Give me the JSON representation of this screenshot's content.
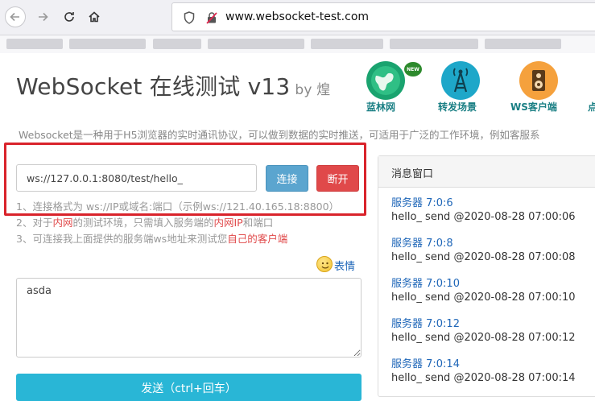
{
  "browser": {
    "url": "www.websocket-test.com"
  },
  "header": {
    "title": "WebSocket 在线测试 v13",
    "by": "by 煌",
    "nav": [
      {
        "label": "蓝林网",
        "icon": "globe-icon",
        "color": "#1aa36f"
      },
      {
        "label": "转发场景",
        "icon": "antenna-icon",
        "color": "#1ea7c9"
      },
      {
        "label": "WS客户端",
        "icon": "speaker-icon",
        "color": "#f5a13d"
      },
      {
        "label": "点"
      }
    ],
    "new_badge": "NEW"
  },
  "intro": "Websocket是一种用于H5浏览器的实时通讯协议，可以做到数据的实时推送，可适用于广泛的工作环境，例如客服系",
  "connection": {
    "url_value": "ws://127.0.0.1:8080/test/hello_",
    "connect_label": "连接",
    "disconnect_label": "断开"
  },
  "tips": {
    "tip1": "1、连接格式为 ws://IP或域名:端口（示例ws://121.40.165.18:8800）",
    "tip2_pre": "2、对于",
    "tip2_hl1": "内网",
    "tip2_mid": "的测试环境，只需填入服务端的",
    "tip2_hl2": "内网IP",
    "tip2_post": "和端口",
    "tip3_pre": "3、可连接我上面提供的服务端ws地址来测试您",
    "tip3_hl": "自己的客户端"
  },
  "emoji_label": "表情",
  "message_input": "asda",
  "send_label": "发送（ctrl+回车）",
  "panel": {
    "title": "消息窗口",
    "messages": [
      {
        "from": "服务器 7:0:6",
        "body": "hello_ send @2020-08-28 07:00:06"
      },
      {
        "from": "服务器 7:0:8",
        "body": "hello_ send @2020-08-28 07:00:08"
      },
      {
        "from": "服务器 7:0:10",
        "body": "hello_ send @2020-08-28 07:00:10"
      },
      {
        "from": "服务器 7:0:12",
        "body": "hello_ send @2020-08-28 07:00:12"
      },
      {
        "from": "服务器 7:0:14",
        "body": "hello_ send @2020-08-28 07:00:14"
      }
    ]
  },
  "colors": {
    "highlight_box": "#d9232b",
    "connect": "#5ba5cf",
    "disconnect": "#e0494a",
    "send": "#29b6d6",
    "link": "#1e66b8"
  }
}
